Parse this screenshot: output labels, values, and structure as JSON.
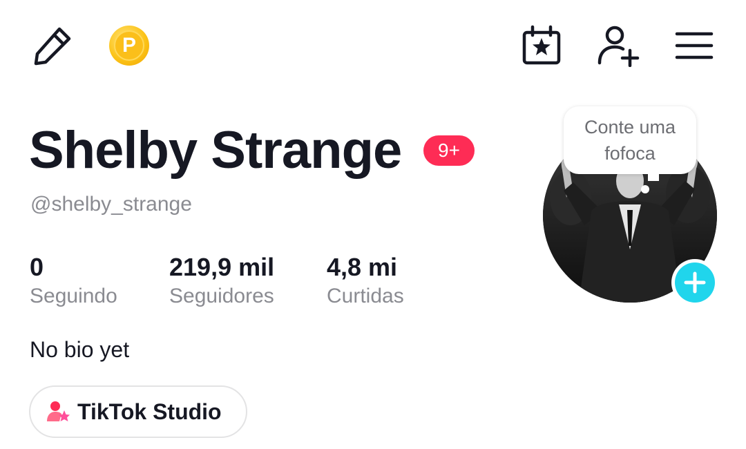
{
  "toolbar": {
    "edit_icon": "pencil-icon",
    "points_icon": "points-coin-icon",
    "points_letter": "P",
    "calendar_icon": "calendar-star-icon",
    "add_user_icon": "add-user-icon",
    "menu_icon": "hamburger-menu-icon"
  },
  "profile": {
    "display_name": "Shelby Strange",
    "notification_badge": "9+",
    "username": "@shelby_strange",
    "bio": "No bio yet",
    "bubble_text": "Conte uma fofoca",
    "avatar_icon": "profile-photo",
    "avatar_add_icon": "plus-icon"
  },
  "stats": [
    {
      "value": "0",
      "label": "Seguindo"
    },
    {
      "value": "219,9 mil",
      "label": "Seguidores"
    },
    {
      "value": "4,8 mi",
      "label": "Curtidas"
    }
  ],
  "studio": {
    "label": "TikTok Studio",
    "icon": "creator-studio-icon"
  },
  "colors": {
    "badge": "#fe2c55",
    "accent_add": "#20d5ec",
    "secondary_text": "#8a8b91",
    "coin": "#fcc419"
  }
}
